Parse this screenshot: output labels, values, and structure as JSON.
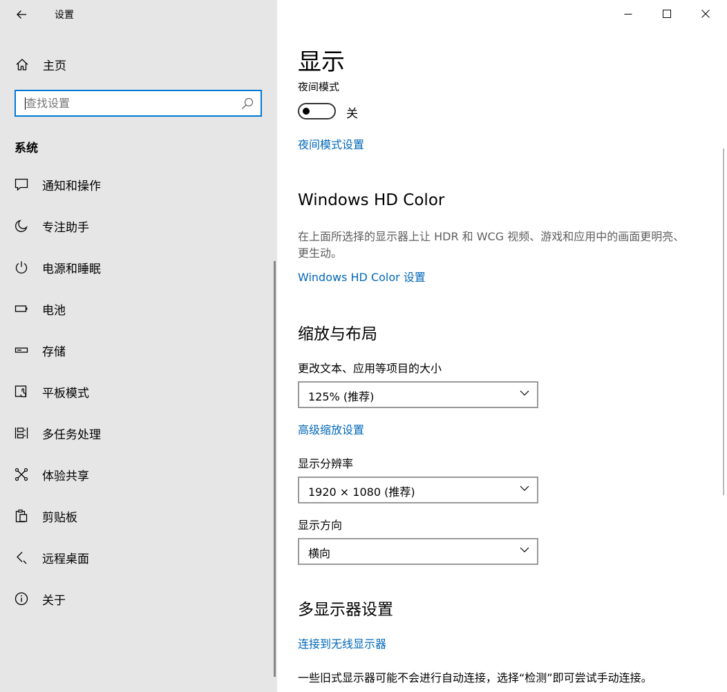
{
  "window": {
    "app_title": "设置",
    "controls": {
      "minimize": "minimize-icon",
      "maximize": "maximize-icon",
      "close": "close-icon"
    }
  },
  "sidebar": {
    "home_label": "主页",
    "search": {
      "placeholder": "查找设置",
      "value": ""
    },
    "section_title": "系统",
    "items": [
      {
        "label": "通知和操作",
        "icon": "notification-icon"
      },
      {
        "label": "专注助手",
        "icon": "moon-icon"
      },
      {
        "label": "电源和睡眠",
        "icon": "power-icon"
      },
      {
        "label": "电池",
        "icon": "battery-icon"
      },
      {
        "label": "存储",
        "icon": "storage-icon"
      },
      {
        "label": "平板模式",
        "icon": "tablet-mode-icon"
      },
      {
        "label": "多任务处理",
        "icon": "multitasking-icon"
      },
      {
        "label": "体验共享",
        "icon": "share-icon"
      },
      {
        "label": "剪贴板",
        "icon": "clipboard-icon"
      },
      {
        "label": "远程桌面",
        "icon": "remote-desktop-icon"
      },
      {
        "label": "关于",
        "icon": "info-icon"
      }
    ]
  },
  "main": {
    "page_title": "显示",
    "night_light": {
      "label": "夜间模式",
      "state_text": "关",
      "on": false,
      "settings_link": "夜间模式设置"
    },
    "hd_color": {
      "heading": "Windows HD Color",
      "description": "在上面所选择的显示器上让 HDR 和 WCG 视频、游戏和应用中的画面更明亮、更生动。",
      "settings_link": "Windows HD Color 设置"
    },
    "scale_layout": {
      "heading": "缩放与布局",
      "scale_label": "更改文本、应用等项目的大小",
      "scale_value": "125% (推荐)",
      "advanced_link": "高级缩放设置",
      "resolution_label": "显示分辨率",
      "resolution_value": "1920 × 1080 (推荐)",
      "orientation_label": "显示方向",
      "orientation_value": "横向"
    },
    "multi_display": {
      "heading": "多显示器设置",
      "wireless_link": "连接到无线显示器",
      "note": "一些旧式显示器可能不会进行自动连接，选择“检测”即可尝试手动连接。"
    }
  },
  "colors": {
    "accent": "#0078d7",
    "link": "#0067b8",
    "sidebar_bg": "#e6e6e6",
    "description_text": "#5d5d5d"
  }
}
